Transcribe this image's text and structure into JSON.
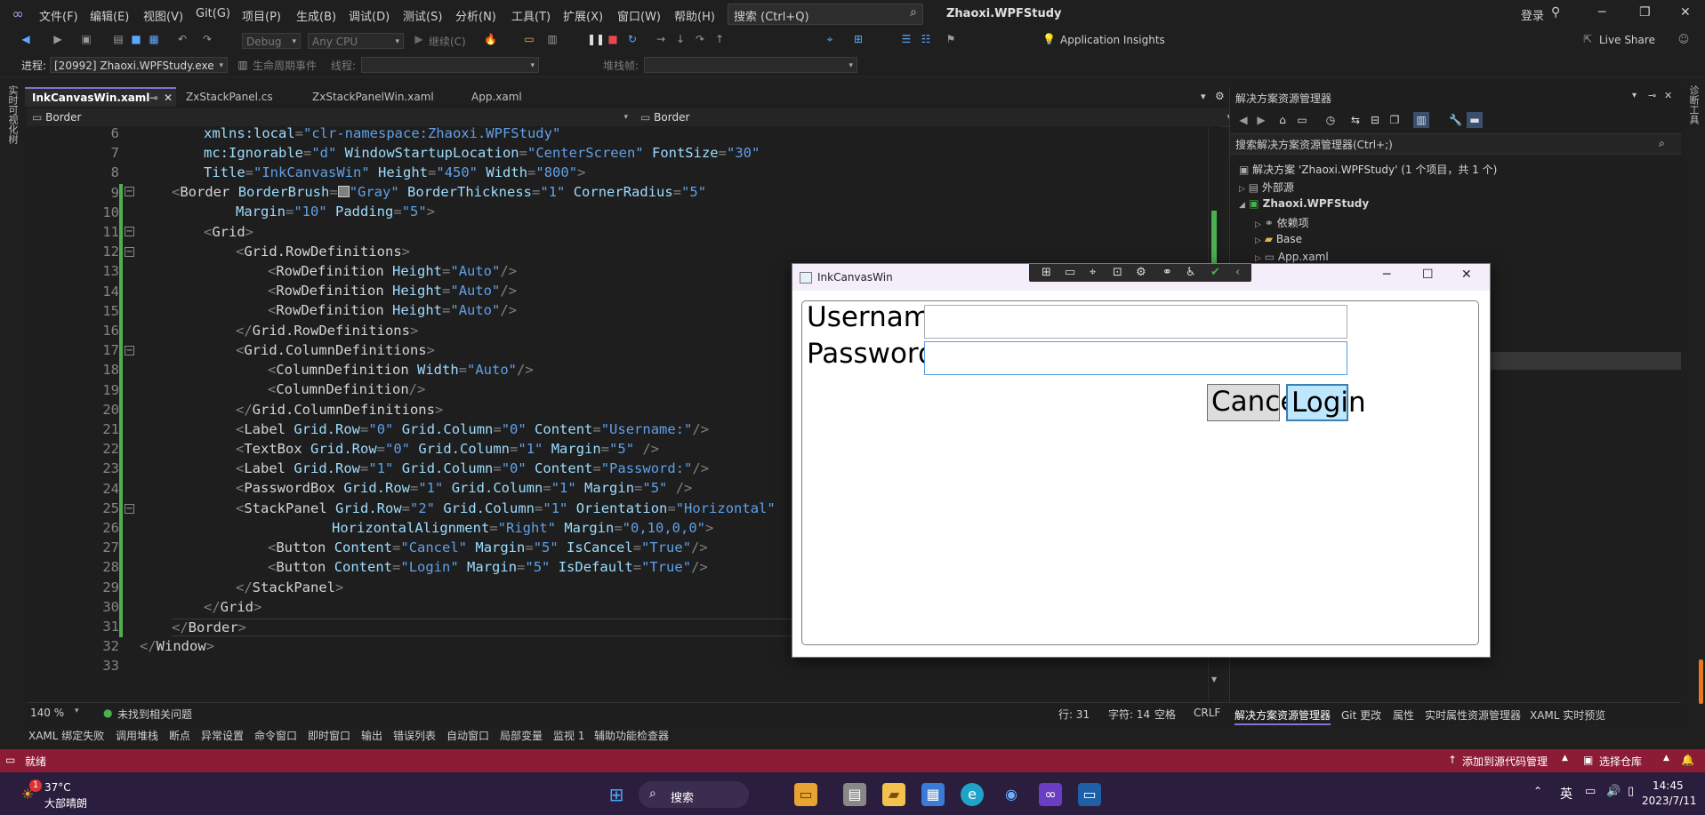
{
  "menu": {
    "items": [
      "文件(F)",
      "编辑(E)",
      "视图(V)",
      "Git(G)",
      "项目(P)",
      "生成(B)",
      "调试(D)",
      "测试(S)",
      "分析(N)",
      "工具(T)",
      "扩展(X)",
      "窗口(W)",
      "帮助(H)"
    ],
    "search_placeholder": "搜索 (Ctrl+Q)",
    "solution_title": "Zhaoxi.WPFStudy",
    "login": "登录"
  },
  "toolbar": {
    "config": "Debug",
    "platform": "Any CPU",
    "continue": "继续(C)",
    "app_insights": "Application Insights",
    "live_share": "Live Share",
    "process_label": "进程:",
    "process_value": "[20992] Zhaoxi.WPFStudy.exe",
    "lifecycle": "生命周期事件",
    "thread_label": "线程:",
    "stackframe_label": "堆栈帧:"
  },
  "left_strip": "实时可视化树",
  "right_strip": "诊断工具",
  "tabs": [
    {
      "label": "InkCanvasWin.xaml",
      "active": true
    },
    {
      "label": "ZxStackPanel.cs",
      "active": false
    },
    {
      "label": "ZxStackPanelWin.xaml",
      "active": false
    },
    {
      "label": "App.xaml",
      "active": false
    }
  ],
  "nav": {
    "left": "Border",
    "right": "Border"
  },
  "code": {
    "line_numbers": [
      "6",
      "7",
      "8",
      "9",
      "10",
      "11",
      "12",
      "13",
      "14",
      "15",
      "16",
      "17",
      "18",
      "19",
      "20",
      "21",
      "22",
      "23",
      "24",
      "25",
      "26",
      "27",
      "28",
      "29",
      "30",
      "31",
      "32",
      "33"
    ]
  },
  "editor_status": {
    "zoom": "140 %",
    "issues": "未找到相关问题",
    "line": "行: 31",
    "char": "字符: 14",
    "space": "空格",
    "eol": "CRLF"
  },
  "tool_tabs": [
    "XAML 绑定失败",
    "调用堆栈",
    "断点",
    "异常设置",
    "命令窗口",
    "即时窗口",
    "输出",
    "错误列表",
    "自动窗口",
    "局部变量",
    "监视 1",
    "辅助功能检查器"
  ],
  "status": {
    "ready": "就绪",
    "add_source": "添加到源代码管理",
    "select_repo": "选择仓库"
  },
  "taskbar": {
    "temp": "37°C",
    "weather": "大部晴朗",
    "search": "搜索",
    "ime": "英",
    "time": "14:45",
    "date": "2023/7/11",
    "weather_badge": "1"
  },
  "solution_explorer": {
    "title": "解决方案资源管理器",
    "search": "搜索解决方案资源管理器(Ctrl+;)",
    "items": [
      {
        "label": "解决方案 'Zhaoxi.WPFStudy' (1 个项目，共 1 个)"
      },
      {
        "label": "外部源"
      },
      {
        "label": "Zhaoxi.WPFStudy"
      },
      {
        "label": "依赖项"
      },
      {
        "label": "Base"
      },
      {
        "label": "App.xaml"
      }
    ],
    "bottom_tabs": [
      "解决方案资源管理器",
      "Git 更改",
      "属性",
      "实时属性资源管理器",
      "XAML 实时预览"
    ]
  },
  "wpf_window": {
    "title": "InkCanvasWin",
    "username_label": "Username:",
    "password_label": "Password:",
    "cancel": "Cancel",
    "login": "Login"
  }
}
